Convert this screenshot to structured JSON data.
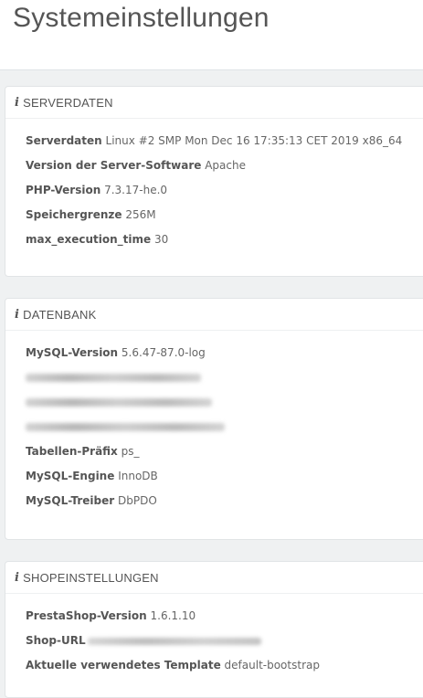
{
  "page": {
    "title": "Systemeinstellungen"
  },
  "server": {
    "heading": "SERVERDATEN",
    "rows": [
      {
        "label": "Serverdaten",
        "value": "Linux #2 SMP Mon Dec 16 17:35:13 CET 2019 x86_64"
      },
      {
        "label": "Version der Server-Software",
        "value": "Apache"
      },
      {
        "label": "PHP-Version",
        "value": "7.3.17-he.0"
      },
      {
        "label": "Speichergrenze",
        "value": "256M"
      },
      {
        "label": "max_execution_time",
        "value": "30"
      }
    ]
  },
  "database": {
    "heading": "DATENBANK",
    "rows": [
      {
        "label": "MySQL-Version",
        "value": "5.6.47-87.0-log"
      },
      {
        "label": "Tabellen-Präfix",
        "value": "ps_"
      },
      {
        "label": "MySQL-Engine",
        "value": "InnoDB"
      },
      {
        "label": "MySQL-Treiber",
        "value": "DbPDO"
      }
    ]
  },
  "shop": {
    "heading": "SHOPEINSTELLUNGEN",
    "rows": [
      {
        "label": "PrestaShop-Version",
        "value": "1.6.1.10"
      },
      {
        "label": "Shop-URL",
        "value": ""
      },
      {
        "label": "Aktuelle verwendetes Template",
        "value": "default-bootstrap"
      }
    ]
  },
  "icons": {
    "info": "info-icon"
  }
}
